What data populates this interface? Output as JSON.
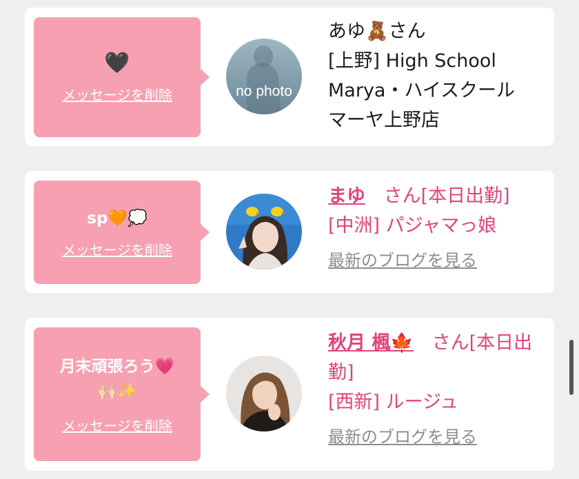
{
  "cards": [
    {
      "message_emoji": "🖤",
      "delete_label": "メッセージを削除",
      "avatar_text": "no photo",
      "name_prefix": "あゆ🧸さん",
      "line2": "[上野] High School",
      "line3": "Marya・ハイスクール",
      "line4": "マーヤ上野店"
    },
    {
      "message": "sp🧡💭",
      "delete_label": "メッセージを削除",
      "name": "まゆ",
      "name_suffix": "さん[本日出勤]",
      "line2": "[中洲] パジャマっ娘",
      "blog_link": "最新のブログを見る"
    },
    {
      "message": "月末頑張ろう💗",
      "message2": "🙌🏻✨",
      "delete_label": "メッセージを削除",
      "name": "秋月 楓🍁",
      "name_suffix": "さん[本日出勤]",
      "line2": "[西新] ルージュ",
      "blog_link": "最新のブログを見る"
    }
  ],
  "colors": {
    "bubble": "#f7a0b2",
    "accent": "#e2437a",
    "background": "#efeff1"
  }
}
